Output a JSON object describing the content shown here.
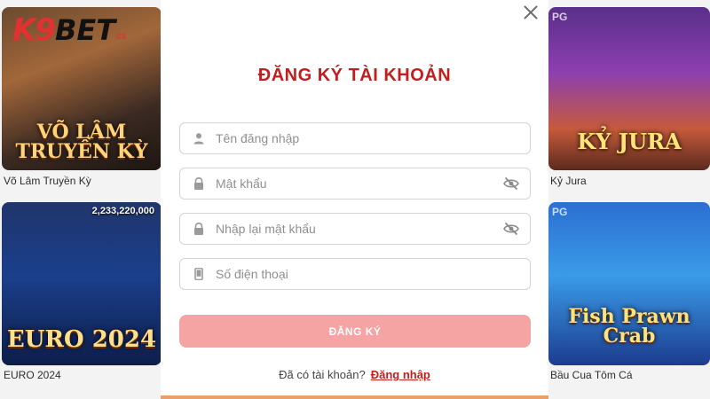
{
  "background": {
    "brand": {
      "logo_main": "K9",
      "logo_bet": "BET",
      "logo_suffix": "CX"
    },
    "games": [
      {
        "title": "VÕ LÂM TRUYỀN KỲ",
        "label": "Võ Lâm Truyền Kỳ"
      },
      {
        "title": "EURO 2024",
        "label": "EURO 2024",
        "jackpot": "2,233,220,000"
      },
      {
        "title": "KỶ JURA",
        "label": "Kỷ Jura",
        "provider": "PG"
      },
      {
        "title": "Fish Prawn Crab",
        "label": "Bầu Cua Tôm Cá",
        "provider": "PG"
      }
    ]
  },
  "modal": {
    "title": "ĐĂNG KÝ TÀI KHOẢN",
    "fields": [
      {
        "placeholder": "Tên đăng nhập",
        "icon": "user-icon"
      },
      {
        "placeholder": "Mật khẩu",
        "icon": "lock-icon",
        "toggle_icon": "eye-off-icon"
      },
      {
        "placeholder": "Nhập lại mật khẩu",
        "icon": "lock-icon",
        "toggle_icon": "eye-off-icon"
      },
      {
        "placeholder": "Số điện thoại",
        "icon": "phone-icon"
      }
    ],
    "submit_label": "ĐĂNG KÝ",
    "footer_text": "Đã có tài khoản?",
    "login_link": "Đăng nhập"
  },
  "colors": {
    "title_red": "#c21e1e",
    "submit_bg": "#f5a3a3",
    "border": "#d4d4d4"
  }
}
